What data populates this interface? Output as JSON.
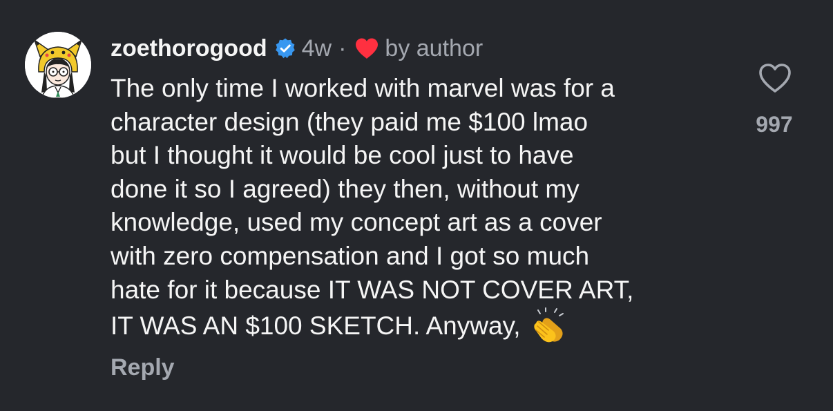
{
  "comment": {
    "username": "zoethorogood",
    "verified_icon": "verified-badge-icon",
    "time": "4w",
    "separator": "·",
    "author_like_label": "by author",
    "text_lines": [
      "The only time I worked with marvel was for a",
      "character design (they paid me $100 lmao",
      "but I thought it would be cool just to have",
      "done it so I agreed) they then, without my",
      "knowledge, used my concept art as a cover",
      "with zero compensation and I got so much",
      "hate for it because IT WAS NOT COVER ART,",
      "IT WAS AN $100 SKETCH. Anyway,"
    ],
    "emoji": "clapping-hands-icon",
    "reply_label": "Reply",
    "like_count": "997"
  },
  "colors": {
    "background": "#25272c",
    "primary_text": "#f5f5f5",
    "secondary_text": "#a4a8b0",
    "verified_blue": "#3897f0",
    "author_heart_red": "#ff3040"
  }
}
